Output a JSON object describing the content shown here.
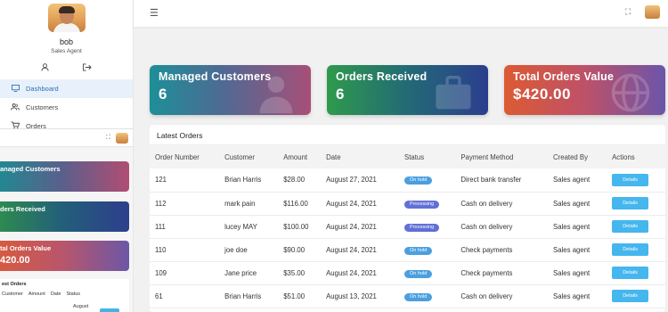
{
  "user": {
    "name": "bob",
    "role": "Sales Agent"
  },
  "sidebar": {
    "icons": {
      "profile": "user-icon",
      "logout": "logout-icon"
    },
    "items": [
      {
        "label": "Dashboard",
        "icon": "monitor-icon",
        "active": true
      },
      {
        "label": "Customers",
        "icon": "users-icon",
        "active": false
      },
      {
        "label": "Orders",
        "icon": "cart-icon",
        "active": false
      }
    ]
  },
  "preview": {
    "cards": [
      {
        "title": "anaged Customers",
        "value": ""
      },
      {
        "title": "ders Received",
        "value": ""
      },
      {
        "title": "tal Orders Value",
        "value": "420.00"
      }
    ],
    "table_title": "est Orders",
    "columns": [
      "Customer",
      "Amount",
      "Date",
      "Status"
    ],
    "date_fragment": "August"
  },
  "stats": [
    {
      "title": "Managed Customers",
      "value": "6",
      "icon": "user-tie-icon"
    },
    {
      "title": "Orders Received",
      "value": "6",
      "icon": "briefcase-icon"
    },
    {
      "title": "Total Orders Value",
      "value": "$420.00",
      "icon": "globe-icon"
    }
  ],
  "orders": {
    "title": "Latest Orders",
    "columns": [
      "Order Number",
      "Customer",
      "Amount",
      "Date",
      "Status",
      "Payment Method",
      "Created By",
      "Actions"
    ],
    "rows": [
      {
        "number": "121",
        "customer": "Brian Harris",
        "amount": "$28.00",
        "date": "August 27, 2021",
        "status": "On hold",
        "status_type": "hold",
        "payment": "Direct bank transfer",
        "created_by": "Sales agent",
        "action": "Details"
      },
      {
        "number": "112",
        "customer": "mark pain",
        "amount": "$116.00",
        "date": "August 24, 2021",
        "status": "Processing",
        "status_type": "processing",
        "payment": "Cash on delivery",
        "created_by": "Sales agent",
        "action": "Details"
      },
      {
        "number": "111",
        "customer": "lucey MAY",
        "amount": "$100.00",
        "date": "August 24, 2021",
        "status": "Processing",
        "status_type": "processing",
        "payment": "Cash on delivery",
        "created_by": "Sales agent",
        "action": "Details"
      },
      {
        "number": "110",
        "customer": "joe doe",
        "amount": "$90.00",
        "date": "August 24, 2021",
        "status": "On hold",
        "status_type": "hold",
        "payment": "Check payments",
        "created_by": "Sales agent",
        "action": "Details"
      },
      {
        "number": "109",
        "customer": "Jane price",
        "amount": "$35.00",
        "date": "August 24, 2021",
        "status": "On hold",
        "status_type": "hold",
        "payment": "Check payments",
        "created_by": "Sales agent",
        "action": "Details"
      },
      {
        "number": "61",
        "customer": "Brian Harris",
        "amount": "$51.00",
        "date": "August 13, 2021",
        "status": "On hold",
        "status_type": "hold",
        "payment": "Cash on delivery",
        "created_by": "Sales agent",
        "action": "Details"
      }
    ]
  },
  "colors": {
    "accent": "#45b6ee",
    "hold": "#4b9fe0",
    "processing": "#6170d6",
    "active_nav": "#2c6fb7"
  }
}
